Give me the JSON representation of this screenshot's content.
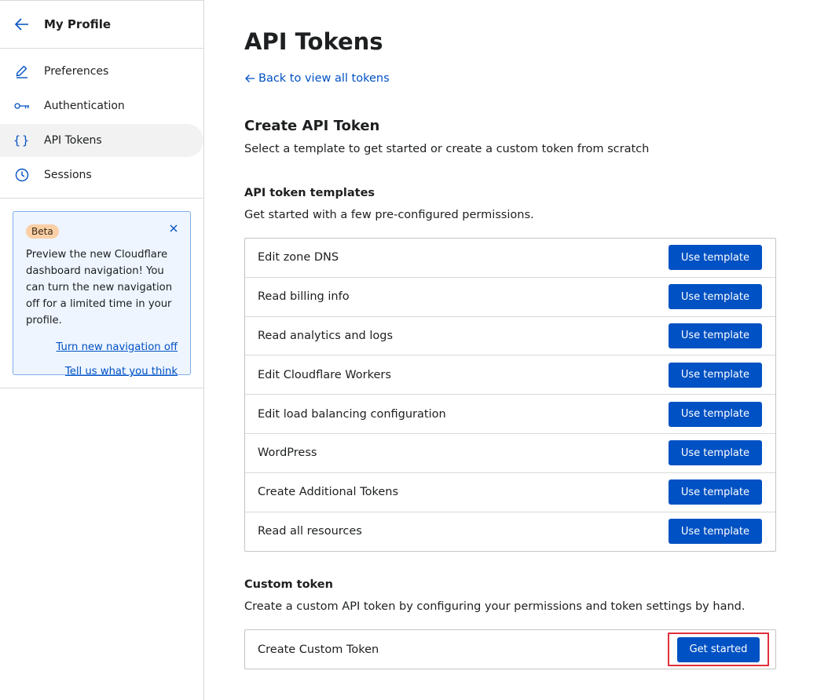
{
  "sidebar": {
    "title": "My Profile",
    "items": [
      {
        "label": "Preferences",
        "icon": "pencil-icon",
        "active": false
      },
      {
        "label": "Authentication",
        "icon": "key-icon",
        "active": false
      },
      {
        "label": "API Tokens",
        "icon": "braces-icon",
        "active": true
      },
      {
        "label": "Sessions",
        "icon": "clock-icon",
        "active": false
      }
    ],
    "beta": {
      "badge": "Beta",
      "text": "Preview the new Cloudflare dashboard navigation! You can turn the new navigation off for a limited time in your profile.",
      "link_off": "Turn new navigation off",
      "link_feedback": "Tell us what you think"
    }
  },
  "main": {
    "title": "API Tokens",
    "back_link": "Back to view all tokens",
    "create_heading": "Create API Token",
    "create_subtitle": "Select a template to get started or create a custom token from scratch",
    "templates_heading": "API token templates",
    "templates_desc": "Get started with a few pre-configured permissions.",
    "template_button": "Use template",
    "templates": [
      "Edit zone DNS",
      "Read billing info",
      "Read analytics and logs",
      "Edit Cloudflare Workers",
      "Edit load balancing configuration",
      "WordPress",
      "Create Additional Tokens",
      "Read all resources"
    ],
    "custom_heading": "Custom token",
    "custom_desc": "Create a custom API token by configuring your permissions and token settings by hand.",
    "custom_name": "Create Custom Token",
    "custom_button": "Get started"
  },
  "colors": {
    "accent": "#0051c3",
    "highlight": "#e0303a",
    "beta_bg": "#eef5ff",
    "badge_bg": "#fbcfa5"
  }
}
